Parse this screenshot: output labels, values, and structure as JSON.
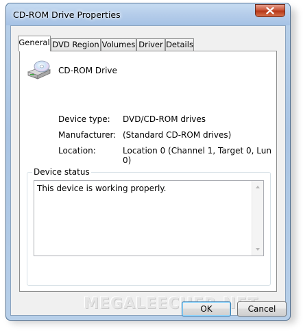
{
  "window": {
    "title": "CD-ROM Drive Properties"
  },
  "tabs": [
    {
      "label": "General"
    },
    {
      "label": "DVD Region"
    },
    {
      "label": "Volumes"
    },
    {
      "label": "Driver"
    },
    {
      "label": "Details"
    }
  ],
  "device": {
    "name": "CD-ROM Drive",
    "rows": [
      {
        "label": "Device type:",
        "value": "DVD/CD-ROM drives"
      },
      {
        "label": "Manufacturer:",
        "value": "(Standard CD-ROM drives)"
      },
      {
        "label": "Location:",
        "value": "Location 0 (Channel 1, Target 0, Lun 0)"
      }
    ]
  },
  "status": {
    "group_title": "Device status",
    "text": "This device is working properly."
  },
  "watermark": "MEGALEECHER.NET",
  "buttons": {
    "ok": "OK",
    "cancel": "Cancel"
  }
}
